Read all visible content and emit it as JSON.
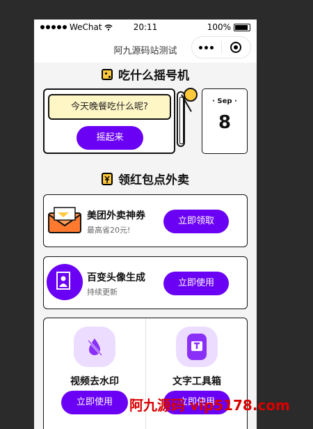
{
  "status_bar": {
    "carrier": "WeChat",
    "time": "20:11",
    "battery": "100%"
  },
  "nav": {
    "title": "阿九源码站测试"
  },
  "shake": {
    "title": "吃什么摇号机",
    "question": "今天晚餐吃什么呢?",
    "button": "摇起来",
    "month": "· Sep ·",
    "day": "8"
  },
  "coupons": {
    "title": "领红包点外卖",
    "items": [
      {
        "name": "美团外卖神券",
        "sub": "最高省20元!",
        "button": "立即领取"
      },
      {
        "name": "百变头像生成",
        "sub": "持续更新",
        "button": "立即使用"
      }
    ]
  },
  "tools": [
    {
      "name": "视频去水印",
      "button": "立即使用"
    },
    {
      "name": "文字工具箱",
      "button": "立即使用"
    }
  ],
  "watermark": "阿九源码 vip5178.com",
  "colors": {
    "accent": "#6a00f4",
    "yellow": "#ffc93d",
    "bubble": "#fff6c6"
  }
}
